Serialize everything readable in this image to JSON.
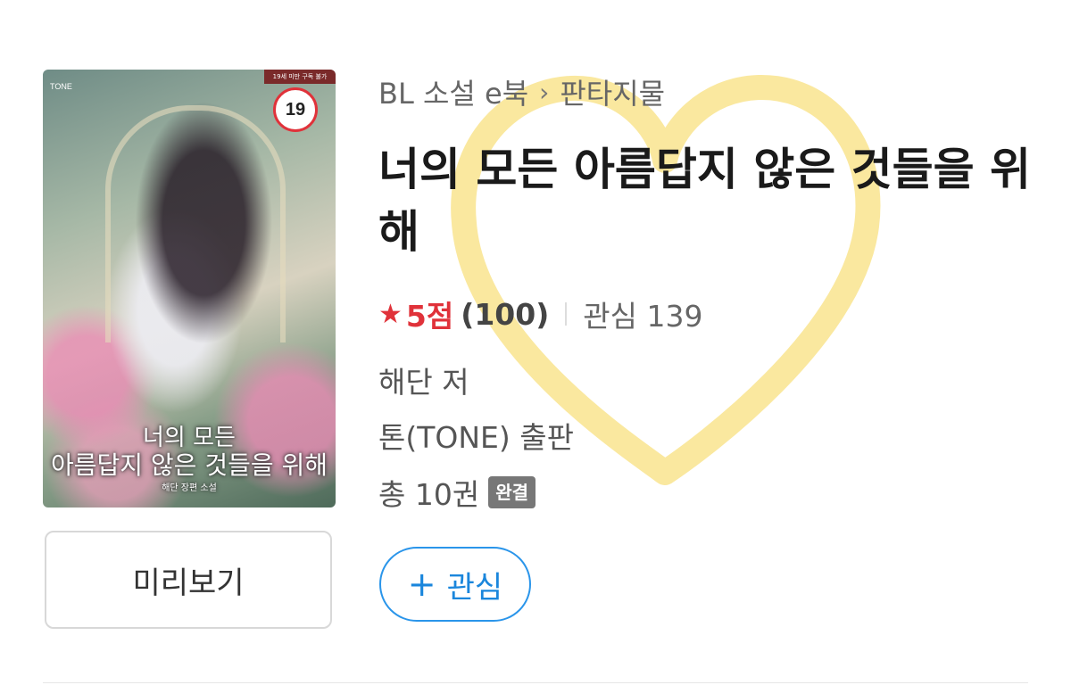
{
  "cover": {
    "alt": "너의 모든 아름답지 않은 것들을 위해 표지",
    "publisher_mark": "TONE",
    "ribbon_text": "19세 미만 구독 불가",
    "age_rating": "19",
    "title_line1": "너의 모든",
    "title_line2": "아름답지 않은 것들을 위해",
    "title_line3": "해단 장편 소설"
  },
  "preview_button": {
    "label": "미리보기"
  },
  "breadcrumb": {
    "category": "BL 소설 e북",
    "separator": "›",
    "subcategory": "판타지물"
  },
  "book": {
    "title": "너의 모든 아름답지 않은 것들을 위해",
    "rating_score": "5점",
    "rating_count": "(100)",
    "interest": "관심 139",
    "author": "해단 저",
    "publisher": "톤(TONE) 출판",
    "volumes": "총 10권",
    "status_badge": "완결"
  },
  "favorite_button": {
    "icon": "+",
    "label": "관심"
  },
  "colors": {
    "accent_red": "#e0323a",
    "accent_blue": "#1a86dc",
    "badge_gray": "#777777"
  }
}
